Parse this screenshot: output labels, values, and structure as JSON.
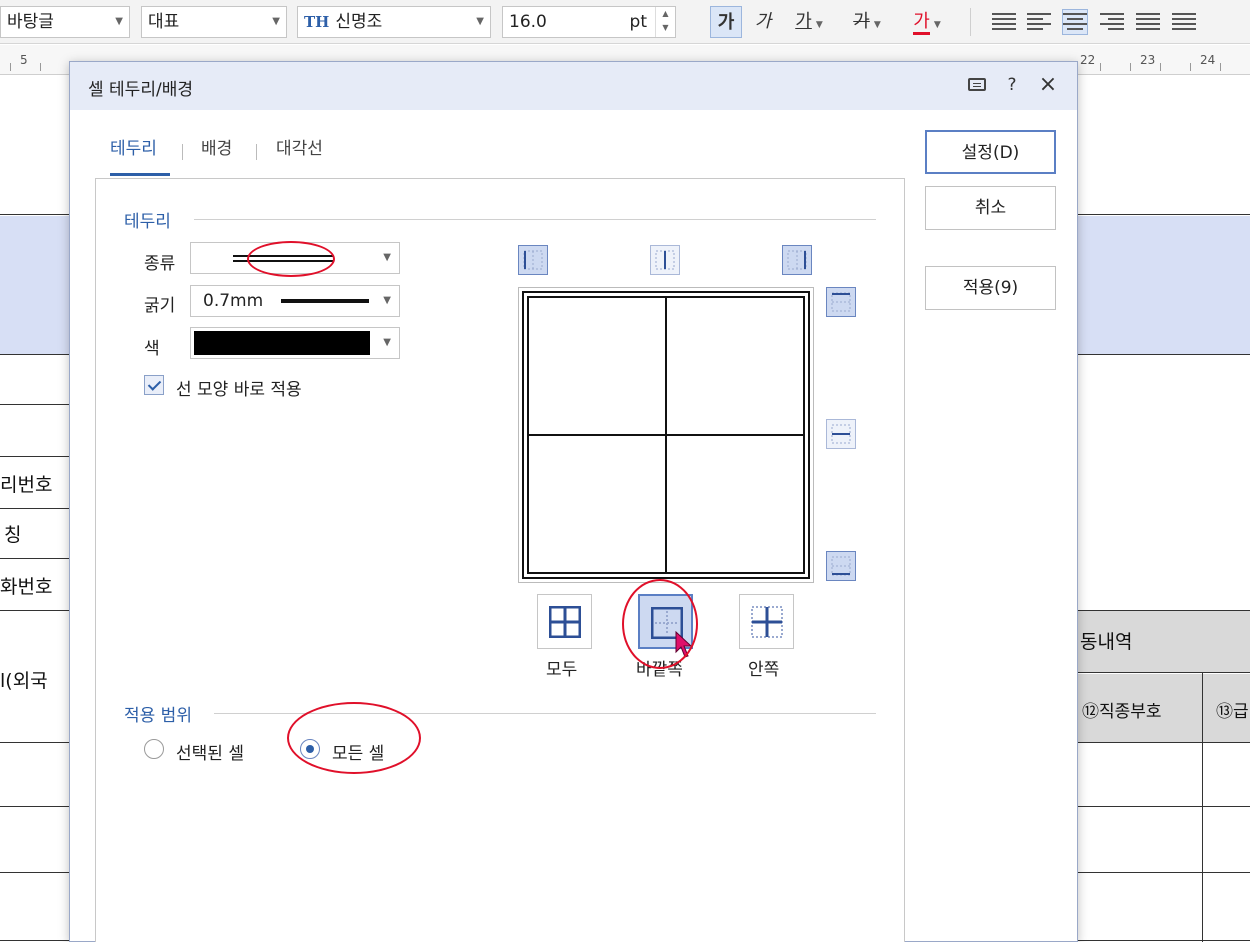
{
  "toolbar": {
    "font_name": "바탕글",
    "style_name": "대표",
    "hanja_font": "신명조",
    "hanja_font_icon": "TH",
    "font_size": "16.0",
    "font_unit": "pt",
    "bold": "가",
    "italic": "가",
    "underline": "가",
    "strike": "가",
    "color_char": "가",
    "text_color": "#e0102a"
  },
  "ruler": {
    "numbers": [
      "5",
      "22",
      "23",
      "24"
    ]
  },
  "document": {
    "left_texts": [
      "리번호",
      "칭",
      "화번호",
      "l(외국",
      ".."
    ],
    "right_header": "동내역",
    "col1": "⑫직종부호",
    "col2": "⑬급"
  },
  "dialog": {
    "title": "셀 테두리/배경",
    "tabs": [
      {
        "label": "테두리",
        "active": true
      },
      {
        "label": "배경",
        "active": false
      },
      {
        "label": "대각선",
        "active": false
      }
    ],
    "border_section": {
      "label": "테두리",
      "type_label": "종류",
      "thickness_label": "굵기",
      "thickness_value": "0.7mm",
      "color_label": "색",
      "color_value": "#000000",
      "apply_shape_label": "선 모양 바로 적용"
    },
    "presets": [
      {
        "label": "모두",
        "active": false
      },
      {
        "label": "바깥쪽",
        "active": true
      },
      {
        "label": "안쪽",
        "active": false
      }
    ],
    "scope_section": {
      "label": "적용 범위",
      "options": [
        {
          "label": "선택된 셀",
          "selected": false
        },
        {
          "label": "모든 셀",
          "selected": true
        }
      ]
    },
    "buttons": {
      "ok": "설정(D)",
      "cancel": "취소",
      "apply": "적용(9)"
    },
    "highlight_color": "#e0102a",
    "accent_color": "#2d5fa8"
  }
}
